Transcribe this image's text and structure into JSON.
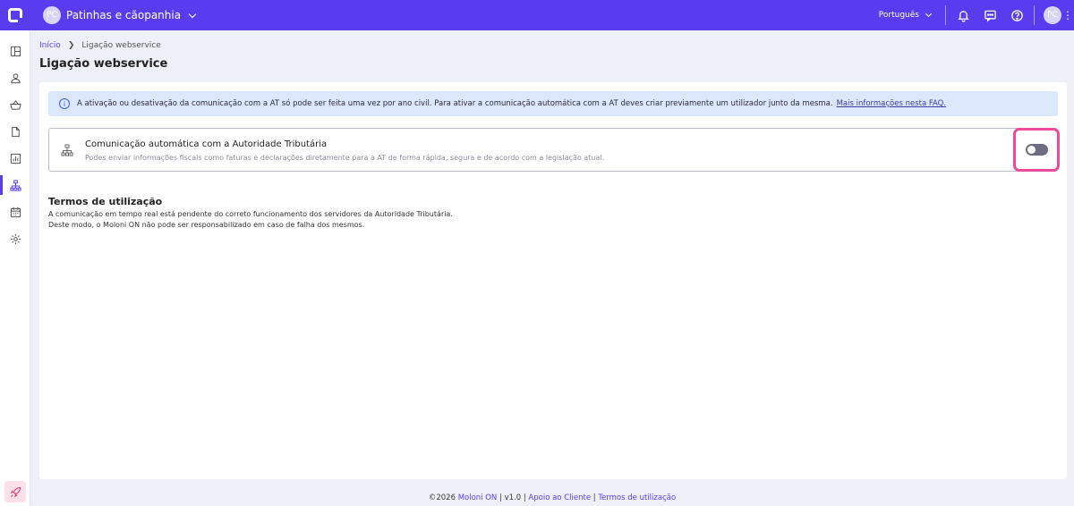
{
  "topbar": {
    "company_initials": "PC",
    "company_name": "Patinhas e cãopanhia",
    "language": "Português",
    "user_initials": "PC"
  },
  "sidebar": {
    "items": [
      {
        "icon": "dashboard-icon"
      },
      {
        "icon": "user-icon"
      },
      {
        "icon": "basket-icon"
      },
      {
        "icon": "document-icon"
      },
      {
        "icon": "chart-icon"
      },
      {
        "icon": "network-icon",
        "active": true
      },
      {
        "icon": "calendar-icon"
      },
      {
        "icon": "gear-icon"
      }
    ]
  },
  "breadcrumb": {
    "home": "Início",
    "current": "Ligação webservice"
  },
  "page_title": "Ligação webservice",
  "info": {
    "text": "A ativação ou desativação da comunicação com a AT só pode ser feita uma vez por ano civil. Para ativar a comunicação automática com a AT deves criar previamente um utilizador junto da mesma.",
    "link": "Mais informações nesta FAQ."
  },
  "webservice": {
    "title": "Comunicação automática com a Autoridade Tributária",
    "description": "Podes enviar informações fiscais como faturas e declarações diretamente para a AT de forma rápida, segura e de acordo com a legislação atual.",
    "enabled": false
  },
  "terms": {
    "title": "Termos de utilização",
    "line1": "A comunicação em tempo real está pendente do correto funcionamento dos servidores da Autoridade Tributária.",
    "line2": "Deste modo, o Moloni ON não pode ser responsabilizado em caso de falha dos mesmos."
  },
  "footer": {
    "copyright": "©2026",
    "brand": "Moloni ON",
    "version": "v1.0",
    "support": "Apoio ao Cliente",
    "terms": "Termos de utilização",
    "sep": "|"
  },
  "colors": {
    "brand": "#5a3cf0",
    "highlight": "#ec4a9b",
    "info_bg": "#dbe8fb"
  }
}
